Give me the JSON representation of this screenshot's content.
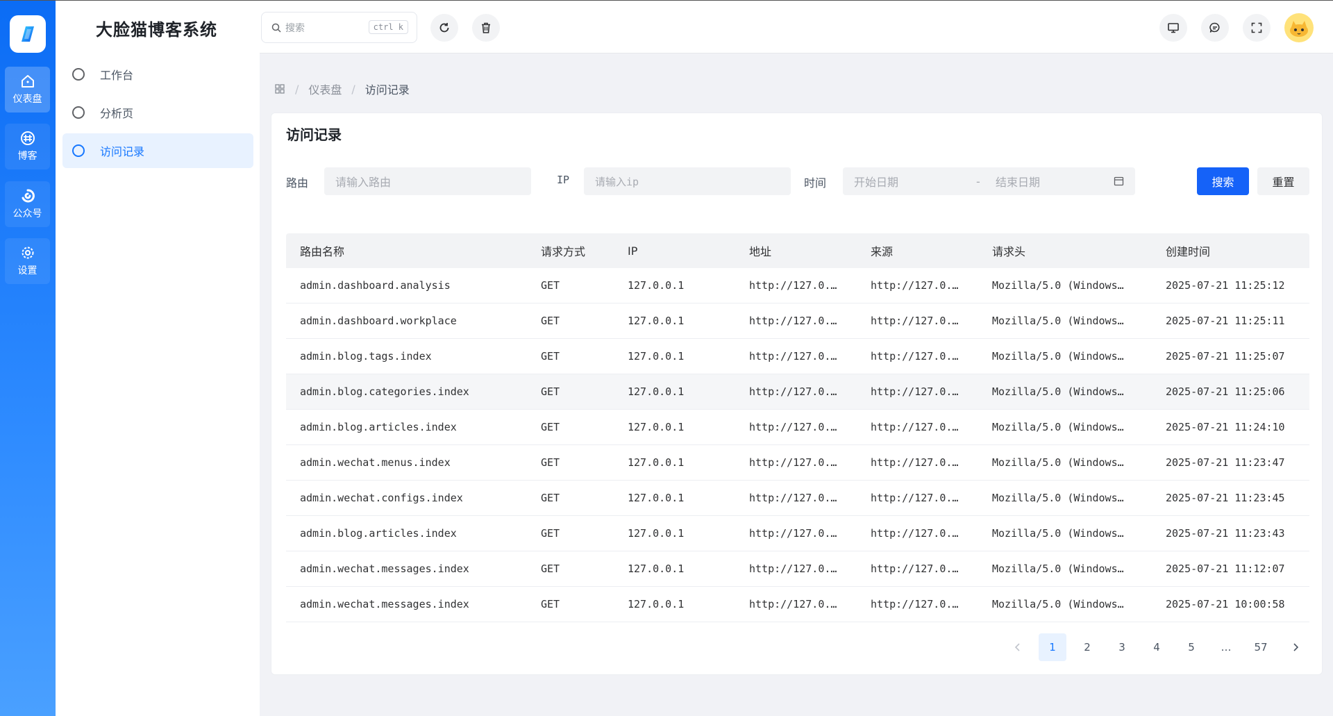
{
  "app": {
    "title": "大脸猫博客系统"
  },
  "rail": {
    "items": [
      {
        "label": "仪表盘",
        "icon": "dashboard-icon"
      },
      {
        "label": "博客",
        "icon": "blog-icon"
      },
      {
        "label": "公众号",
        "icon": "wechat-icon"
      },
      {
        "label": "设置",
        "icon": "gear-icon"
      }
    ]
  },
  "menu": {
    "items": [
      {
        "label": "工作台"
      },
      {
        "label": "分析页"
      },
      {
        "label": "访问记录"
      }
    ]
  },
  "header": {
    "search_placeholder": "搜索",
    "search_shortcut": "ctrl k"
  },
  "breadcrumb": {
    "parent": "仪表盘",
    "current": "访问记录"
  },
  "page": {
    "title": "访问记录",
    "filters": {
      "route_label": "路由",
      "route_placeholder": "请输入路由",
      "ip_label": "IP",
      "ip_placeholder": "请输入ip",
      "time_label": "时间",
      "start_placeholder": "开始日期",
      "range_sep": "-",
      "end_placeholder": "结束日期",
      "search_button": "搜索",
      "reset_button": "重置"
    },
    "table": {
      "columns": [
        "路由名称",
        "请求方式",
        "IP",
        "地址",
        "来源",
        "请求头",
        "创建时间"
      ],
      "rows": [
        [
          "admin.dashboard.analysis",
          "GET",
          "127.0.0.1",
          "http://127.0.…",
          "http://127.0.…",
          "Mozilla/5.0 (Windows…",
          "2025-07-21 11:25:12"
        ],
        [
          "admin.dashboard.workplace",
          "GET",
          "127.0.0.1",
          "http://127.0.…",
          "http://127.0.…",
          "Mozilla/5.0 (Windows…",
          "2025-07-21 11:25:11"
        ],
        [
          "admin.blog.tags.index",
          "GET",
          "127.0.0.1",
          "http://127.0.…",
          "http://127.0.…",
          "Mozilla/5.0 (Windows…",
          "2025-07-21 11:25:07"
        ],
        [
          "admin.blog.categories.index",
          "GET",
          "127.0.0.1",
          "http://127.0.…",
          "http://127.0.…",
          "Mozilla/5.0 (Windows…",
          "2025-07-21 11:25:06"
        ],
        [
          "admin.blog.articles.index",
          "GET",
          "127.0.0.1",
          "http://127.0.…",
          "http://127.0.…",
          "Mozilla/5.0 (Windows…",
          "2025-07-21 11:24:10"
        ],
        [
          "admin.wechat.menus.index",
          "GET",
          "127.0.0.1",
          "http://127.0.…",
          "http://127.0.…",
          "Mozilla/5.0 (Windows…",
          "2025-07-21 11:23:47"
        ],
        [
          "admin.wechat.configs.index",
          "GET",
          "127.0.0.1",
          "http://127.0.…",
          "http://127.0.…",
          "Mozilla/5.0 (Windows…",
          "2025-07-21 11:23:45"
        ],
        [
          "admin.blog.articles.index",
          "GET",
          "127.0.0.1",
          "http://127.0.…",
          "http://127.0.…",
          "Mozilla/5.0 (Windows…",
          "2025-07-21 11:23:43"
        ],
        [
          "admin.wechat.messages.index",
          "GET",
          "127.0.0.1",
          "http://127.0.…",
          "http://127.0.…",
          "Mozilla/5.0 (Windows…",
          "2025-07-21 11:12:07"
        ],
        [
          "admin.wechat.messages.index",
          "GET",
          "127.0.0.1",
          "http://127.0.…",
          "http://127.0.…",
          "Mozilla/5.0 (Windows…",
          "2025-07-21 10:00:58"
        ]
      ]
    },
    "pagination": {
      "pages": [
        "1",
        "2",
        "3",
        "4",
        "5",
        "…",
        "57"
      ],
      "current": "1"
    }
  },
  "colors": {
    "primary": "#1562f8",
    "rail_start": "#0b6cf5",
    "active_bg": "#e8f2ff"
  }
}
